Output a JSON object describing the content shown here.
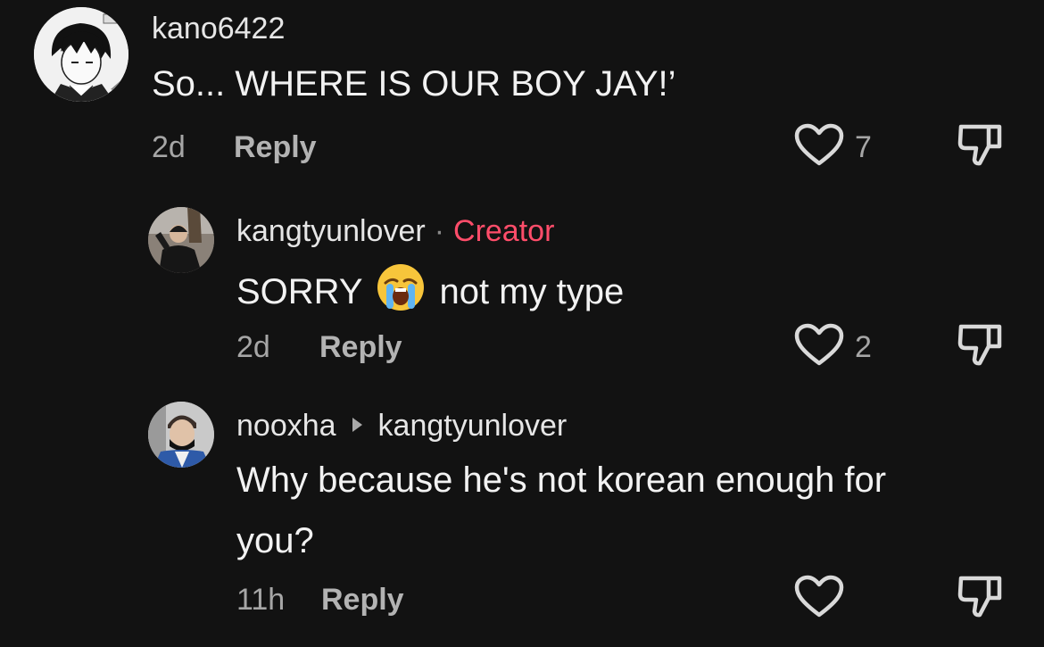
{
  "comments": [
    {
      "username": "kano6422",
      "text": "So... WHERE IS OUR BOY JAY!’",
      "time": "2d",
      "reply_label": "Reply",
      "likes": "7"
    },
    {
      "username": "kangtyunlover",
      "badge_sep": "·",
      "badge": "Creator",
      "text_before": "SORRY",
      "emoji": "loudly-crying-face-emoji",
      "text_after": "not my type",
      "time": "2d",
      "reply_label": "Reply",
      "likes": "2"
    },
    {
      "username": "nooxha",
      "reply_to": "kangtyunlover",
      "text_line1": "Why because he's not korean enough for",
      "text_line2": "you?",
      "time": "11h",
      "reply_label": "Reply",
      "likes": ""
    }
  ],
  "colors": {
    "background": "#121212",
    "creator_badge": "#ff4d6a",
    "secondary_text": "#a6a6a6"
  }
}
